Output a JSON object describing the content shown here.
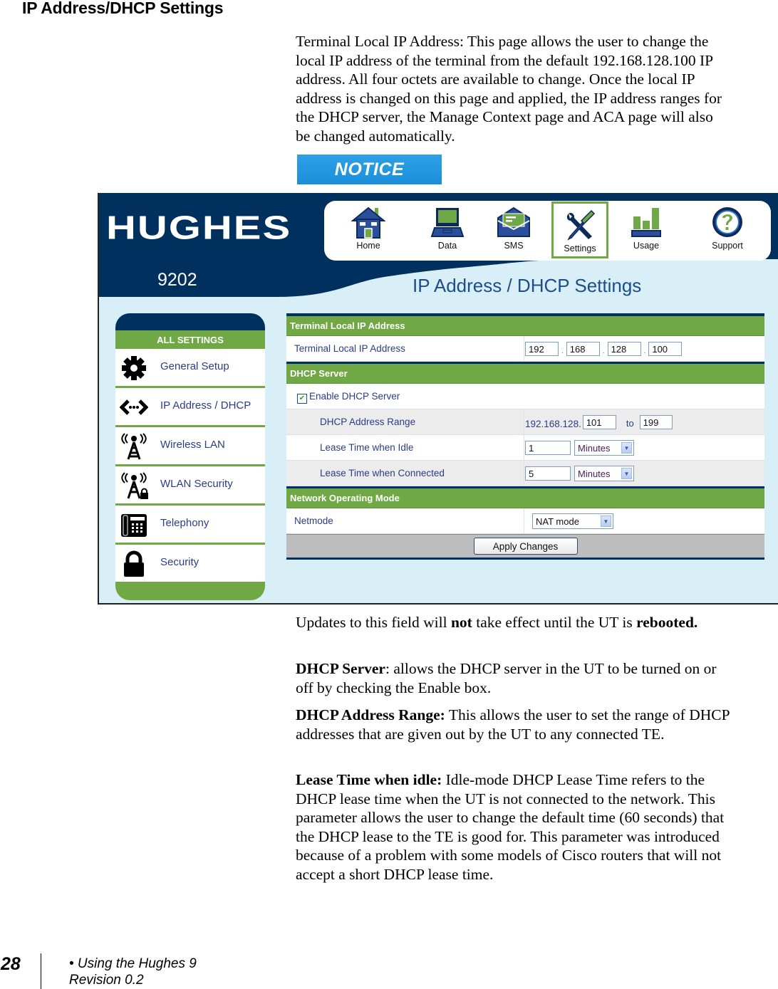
{
  "section_title": "IP Address/DHCP Settings",
  "intro_paragraph": "Terminal Local IP Address:  This page allows the user to change the local IP address of the terminal from the default 192.168.128.100 IP address.  All four octets are available to change.  Once the local IP address is changed on this page and applied, the IP address ranges for the DHCP server, the Manage Context page and ACA page will also be changed automatically.",
  "notice_label": "NOTICE",
  "screenshot": {
    "logo": "HUGHES",
    "model": "9202",
    "page_heading": "IP Address / DHCP Settings",
    "nav": [
      {
        "label": "Home",
        "icon": "home-icon"
      },
      {
        "label": "Data",
        "icon": "laptop-icon"
      },
      {
        "label": "SMS",
        "icon": "envelope-icon"
      },
      {
        "label": "Settings",
        "icon": "tools-icon",
        "active": true
      },
      {
        "label": "Usage",
        "icon": "bar-chart-icon"
      },
      {
        "label": "Support",
        "icon": "help-icon"
      }
    ],
    "sidebar": {
      "title": "ALL SETTINGS",
      "items": [
        {
          "label": "General Setup",
          "icon": "gear-icon"
        },
        {
          "label": "IP Address / DHCP",
          "icon": "network-arrows-icon"
        },
        {
          "label": "Wireless LAN",
          "icon": "wireless-tower-icon"
        },
        {
          "label": "WLAN Security",
          "icon": "wireless-lock-icon"
        },
        {
          "label": "Telephony",
          "icon": "phone-icon"
        },
        {
          "label": "Security",
          "icon": "lock-icon"
        }
      ]
    },
    "sections": {
      "terminal": {
        "header": "Terminal Local IP Address",
        "label": "Terminal Local IP Address",
        "octets": [
          "192",
          "168",
          "128",
          "100"
        ]
      },
      "dhcp": {
        "header": "DHCP Server",
        "enable_label": "Enable DHCP Server",
        "enable_checked": true,
        "range_label": "DHCP Address Range",
        "range_prefix": "192.168.128.",
        "range_start": "101",
        "range_to": "to",
        "range_end": "199",
        "idle_label": "Lease Time when Idle",
        "idle_value": "1",
        "idle_unit": "Minutes",
        "connected_label": "Lease Time when Connected",
        "connected_value": "5",
        "connected_unit": "Minutes"
      },
      "network": {
        "header": "Network Operating Mode",
        "label": "Netmode",
        "value": "NAT mode"
      }
    },
    "apply_button": "Apply Changes"
  },
  "paragraphs": {
    "p2_pre": "Updates to this field will ",
    "p2_bold": "not",
    "p2_post": " take effect until the UT is ",
    "p2_bold2": "rebooted.",
    "p3_bold": "DHCP Server",
    "p3_text": ": allows the DHCP server in the UT to be turned on or off by checking the Enable box.",
    "p4_bold": "DHCP Address Range:",
    "p4_text": "  This allows the user to set the range of DHCP addresses that are given out by the UT to any connected TE.",
    "p5_bold": "Lease Time when idle:",
    "p5_text": "  Idle-mode DHCP Lease Time refers to the DHCP lease time when the UT is not connected to the network.  This parameter allows the user to change the default time (60 seconds) that the DHCP lease to the TE is good for.  This parameter was introduced because of a problem with some models of Cisco routers that will not accept a short DHCP lease time."
  },
  "footer": {
    "page_number": "28",
    "line1": "• Using the Hughes 9",
    "line2": "Revision 0.2"
  },
  "colors": {
    "navy": "#00305e",
    "green": "#6fa844",
    "light_blue": "#d9eff8",
    "notice_blue": "#1a8fd9",
    "link_blue": "#2b3d84"
  }
}
